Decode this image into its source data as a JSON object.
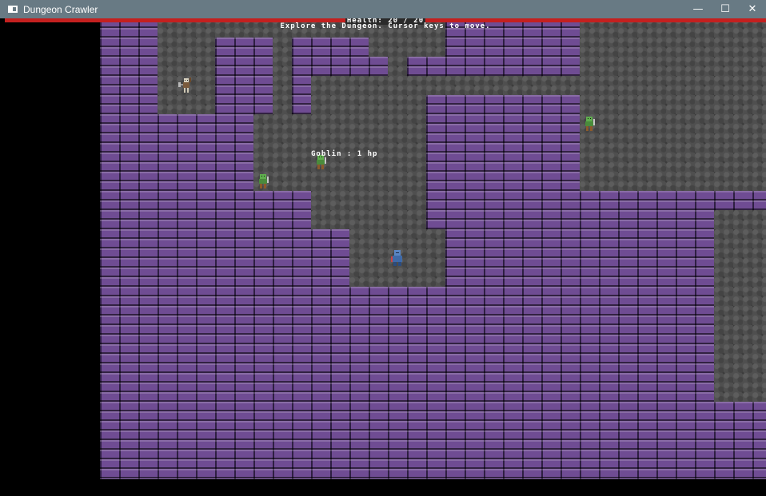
{
  "window": {
    "title": "Dungeon Crawler",
    "minimize_glyph": "—",
    "maximize_glyph": "☐",
    "close_glyph": "✕"
  },
  "hud": {
    "health_text": "Health: 20 / 20",
    "health_current": 20,
    "health_max": 20,
    "health_bar_color": "#c4201f",
    "message": "Explore the Dungeon. Cursor keys to move."
  },
  "entities": {
    "goblin_label": "Goblin : 1 hp",
    "player_icon": "armored-knight-icon",
    "goblin_icon": "goblin-icon",
    "skeleton_icon": "skeleton-axe-icon"
  },
  "colors": {
    "wall": "#6f4c93",
    "floor": "#4f4f4f",
    "background": "#000000"
  }
}
